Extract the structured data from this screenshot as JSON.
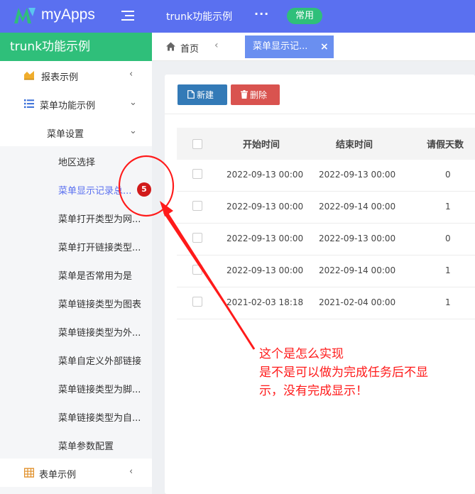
{
  "header": {
    "brand": "myApps",
    "title": "trunk功能示例",
    "more": "···",
    "badge": "常用",
    "logo_color": "#2fbf7a",
    "bar_color": "#5a70f0"
  },
  "sidebar": {
    "heading": "trunk功能示例",
    "items": [
      {
        "label": "报表示例",
        "icon": "chart-icon",
        "arrow": "‹"
      },
      {
        "label": "菜单功能示例",
        "icon": "list-icon",
        "arrow": "⌄"
      },
      {
        "label": "菜单设置",
        "arrow": "⌄"
      }
    ],
    "subitems": [
      {
        "label": "地区选择"
      },
      {
        "label": "菜单显示记录总...",
        "badge": "5"
      },
      {
        "label": "菜单打开类型为网..."
      },
      {
        "label": "菜单打开链接类型..."
      },
      {
        "label": "菜单是否常用为是"
      },
      {
        "label": "菜单链接类型为图表"
      },
      {
        "label": "菜单链接类型为外..."
      },
      {
        "label": "菜单自定义外部链接"
      },
      {
        "label": "菜单链接类型为脚..."
      },
      {
        "label": "菜单链接类型为自..."
      },
      {
        "label": "菜单参数配置"
      }
    ],
    "bottom_item": {
      "label": "表单示例",
      "icon": "table-icon",
      "arrow": "‹"
    }
  },
  "tabs": {
    "home": "首页",
    "prev": "‹",
    "active": "菜单显示记...",
    "close": "×"
  },
  "toolbar": {
    "new_label": "新建",
    "delete_label": "删除"
  },
  "table": {
    "headers": [
      "开始时间",
      "结束时间",
      "请假天数"
    ],
    "rows": [
      [
        "2022-09-13 00:00",
        "2022-09-13 00:00",
        "0"
      ],
      [
        "2022-09-13 00:00",
        "2022-09-14 00:00",
        "1"
      ],
      [
        "2022-09-13 00:00",
        "2022-09-13 00:00",
        "0"
      ],
      [
        "2022-09-13 00:00",
        "2022-09-14 00:00",
        "1"
      ],
      [
        "2021-02-03 18:18",
        "2021-02-04 00:00",
        "1"
      ]
    ]
  },
  "annotation": {
    "lines": [
      "这个是怎么实现",
      "是不是可以做为完成任务后不显",
      "示，没有完成显示！"
    ],
    "color": "#ff1a1a"
  }
}
